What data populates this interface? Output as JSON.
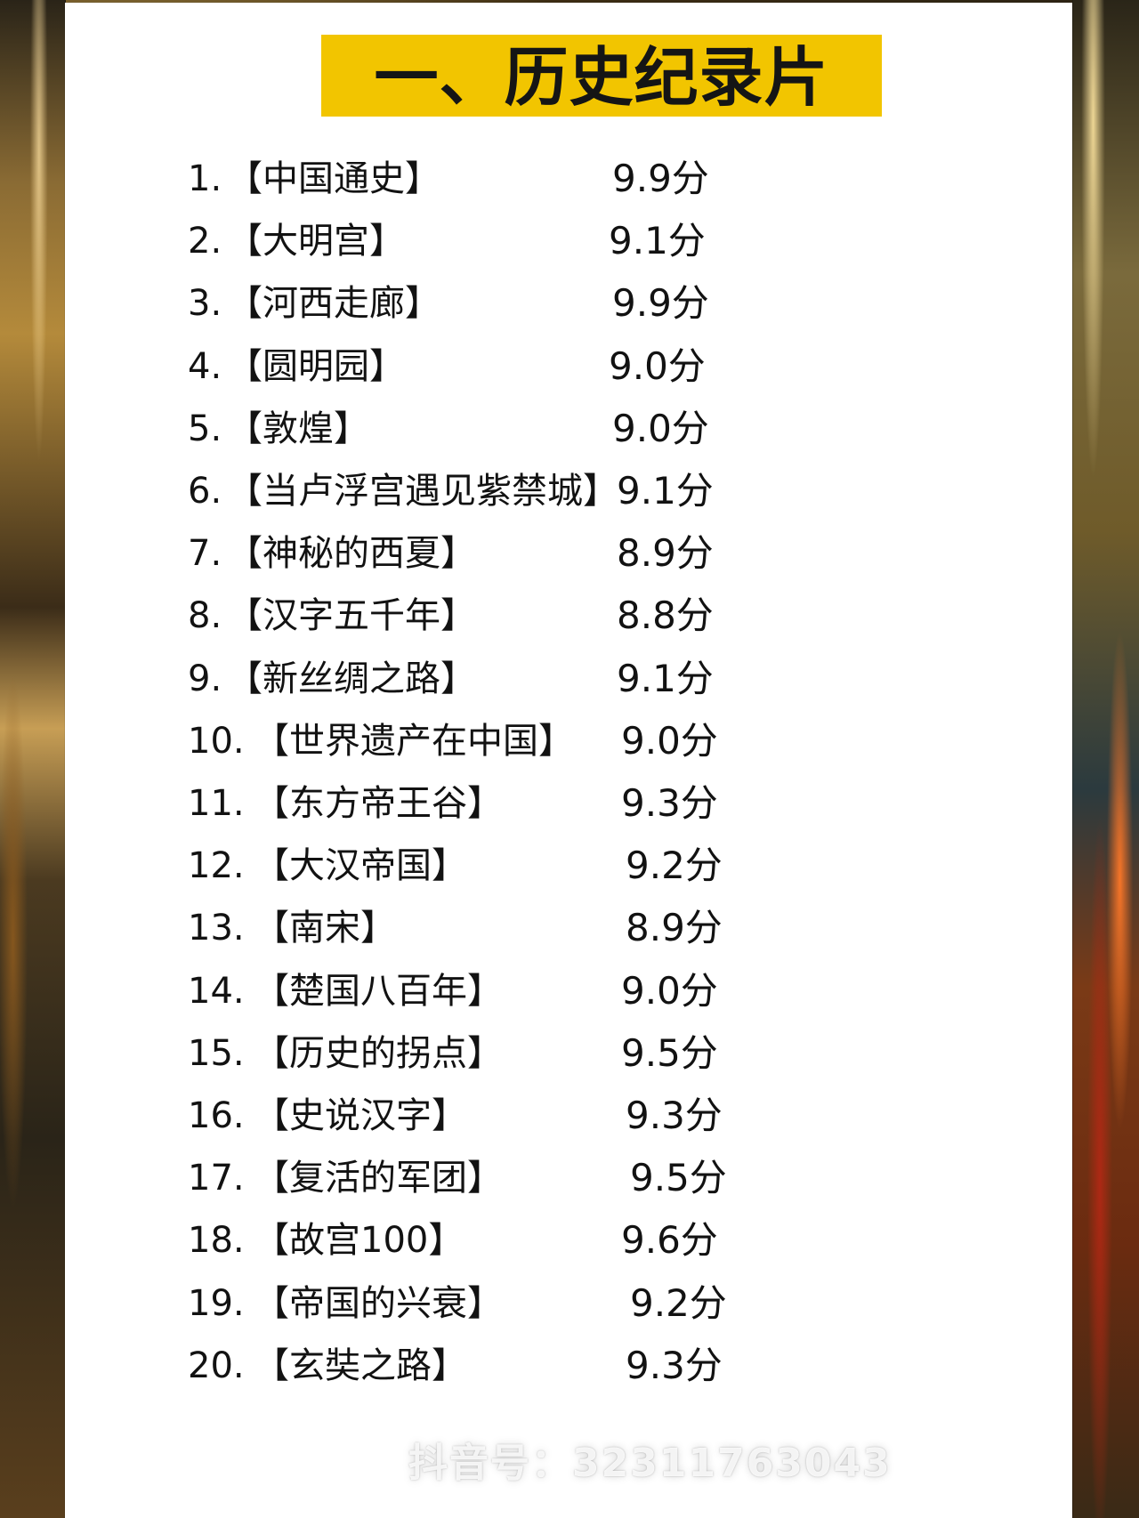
{
  "title": "一、历史纪录片",
  "items": [
    {
      "num": "1.",
      "name": "【中国通史】",
      "score": "9.9分"
    },
    {
      "num": "2.",
      "name": "【大明宫】",
      "score": "9.1分"
    },
    {
      "num": "3.",
      "name": "【河西走廊】",
      "score": "9.9分"
    },
    {
      "num": "4.",
      "name": "【圆明园】",
      "score": "9.0分"
    },
    {
      "num": "5.",
      "name": "【敦煌】",
      "score": "9.0分"
    },
    {
      "num": "6.",
      "name": "【当卢浮宫遇见紫禁城】",
      "score": "9.1分"
    },
    {
      "num": "7.",
      "name": "【神秘的西夏】",
      "score": "8.9分"
    },
    {
      "num": "8.",
      "name": "【汉字五千年】",
      "score": "8.8分"
    },
    {
      "num": "9.",
      "name": "【新丝绸之路】",
      "score": "9.1分"
    },
    {
      "num": "10.",
      "name": "【世界遗产在中国】",
      "score": "9.0分"
    },
    {
      "num": "11.",
      "name": "【东方帝王谷】",
      "score": "9.3分"
    },
    {
      "num": "12.",
      "name": "【大汉帝国】",
      "score": "9.2分"
    },
    {
      "num": "13.",
      "name": "【南宋】",
      "score": "8.9分"
    },
    {
      "num": "14.",
      "name": "【楚国八百年】",
      "score": "9.0分"
    },
    {
      "num": "15.",
      "name": "【历史的拐点】",
      "score": "9.5分"
    },
    {
      "num": "16.",
      "name": "【史说汉字】",
      "score": "9.3分"
    },
    {
      "num": "17.",
      "name": "【复活的军团】",
      "score": "9.5分"
    },
    {
      "num": "18.",
      "name": "【故宫100】",
      "score": "9.6分"
    },
    {
      "num": "19.",
      "name": "【帝国的兴衰】",
      "score": "9.2分"
    },
    {
      "num": "20.",
      "name": "【玄奘之路】",
      "score": "9.3分"
    }
  ],
  "watermark": {
    "text": "抖音号：32311763043",
    "icon": "tiktok-icon"
  }
}
